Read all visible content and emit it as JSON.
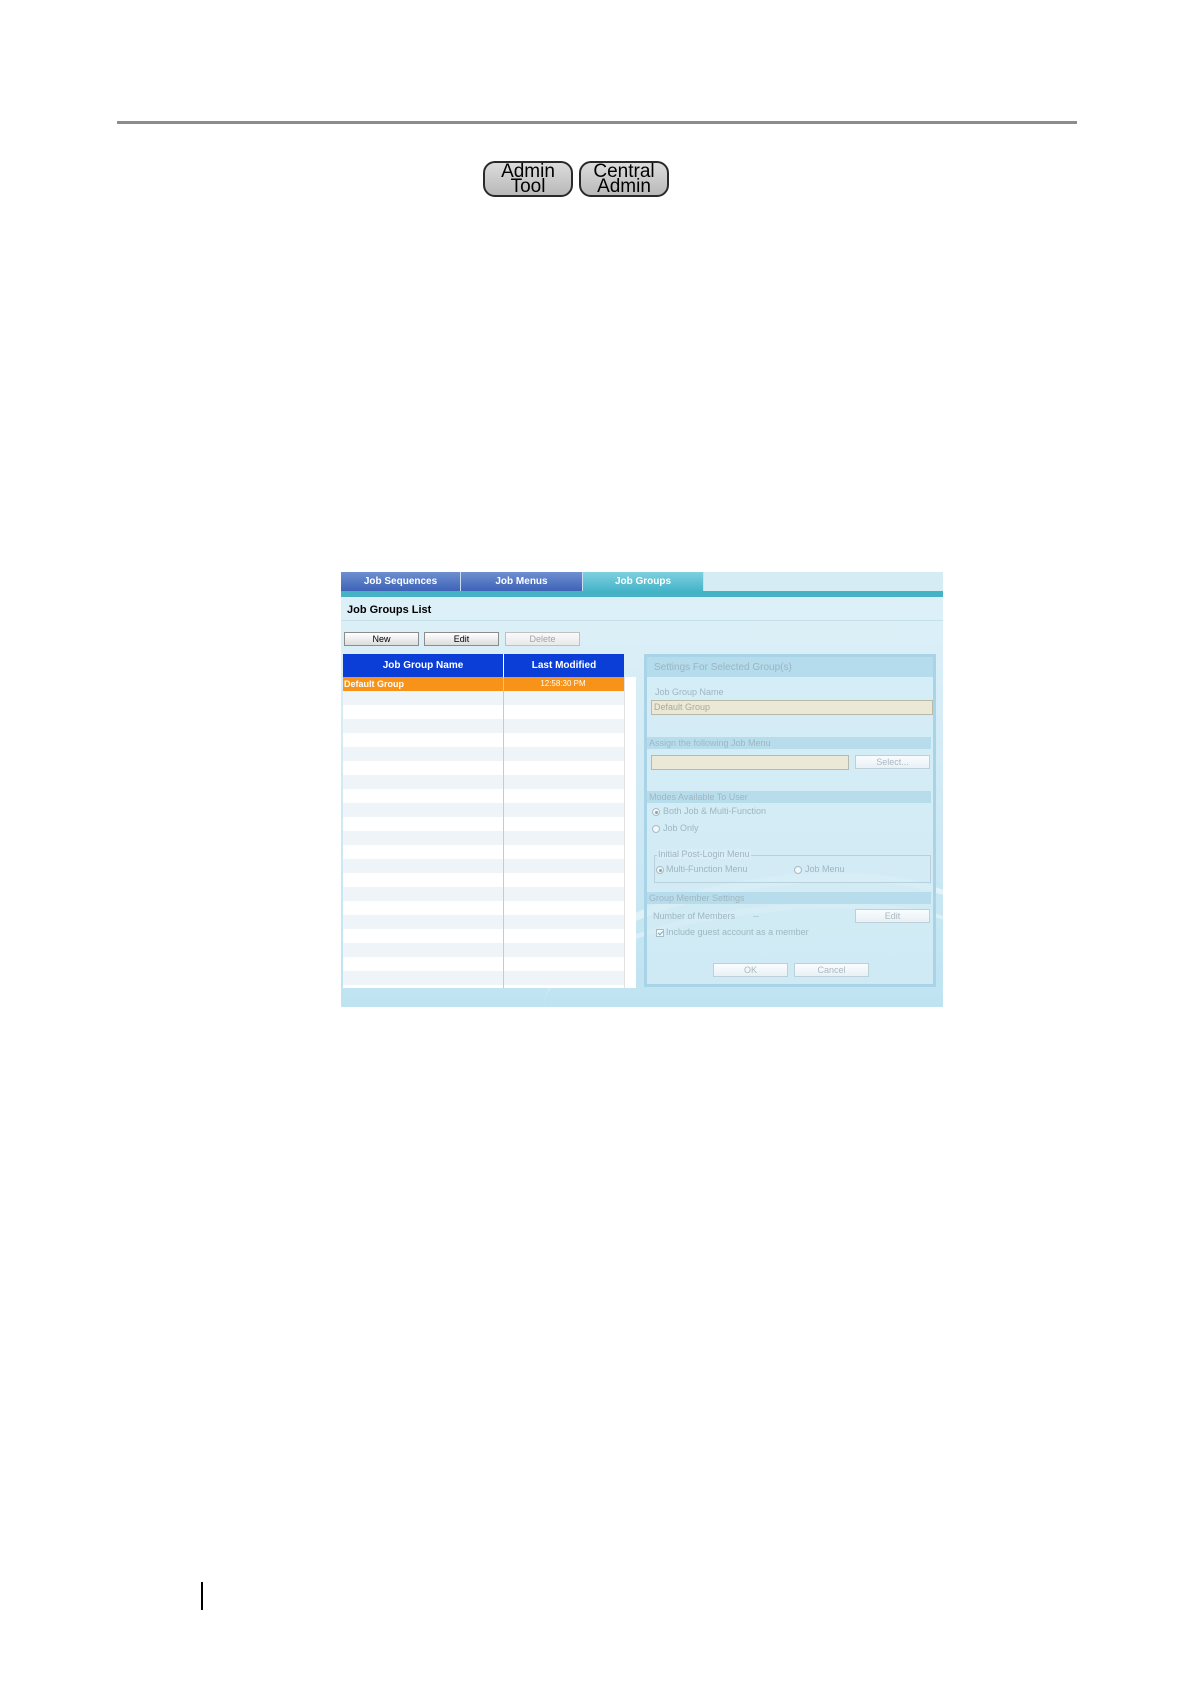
{
  "badges": {
    "admin_tool": [
      "Admin",
      "Tool"
    ],
    "central_admin": [
      "Central",
      "Admin"
    ]
  },
  "tabs": [
    {
      "label": "Job Sequences",
      "active": false
    },
    {
      "label": "Job Menus",
      "active": false
    },
    {
      "label": "Job Groups",
      "active": true
    }
  ],
  "list": {
    "title": "Job Groups List",
    "new_label": "New",
    "edit_label": "Edit",
    "delete_label": "Delete",
    "columns": [
      "Job Group Name",
      "Last Modified"
    ],
    "rows": [
      {
        "name": "Default Group",
        "modified": "12:58:30 PM"
      }
    ]
  },
  "settings": {
    "title": "Settings For Selected Group(s)",
    "name_label": "Job Group Name",
    "name_value": "Default Group",
    "job_menu_section": "Assign the following Job Menu",
    "job_menu_value": "",
    "select_label": "Select...",
    "modes_section": "Modes Available To User",
    "mode_both": "Both Job & Multi-Function",
    "mode_job_only": "Job Only",
    "initial_menu_label": "Initial Post-Login Menu",
    "initial_multi": "Multi-Function Menu",
    "initial_job": "Job Menu",
    "member_section": "Group Member Settings",
    "members_label": "Number of Members",
    "members_value": "--",
    "members_edit": "Edit",
    "guest_label": "Include guest account as a member",
    "ok_label": "OK",
    "cancel_label": "Cancel"
  },
  "colors": {
    "header_blue": "#0a3ed6",
    "selected_orange": "#f79318",
    "active_tab": "#45b4c9"
  }
}
